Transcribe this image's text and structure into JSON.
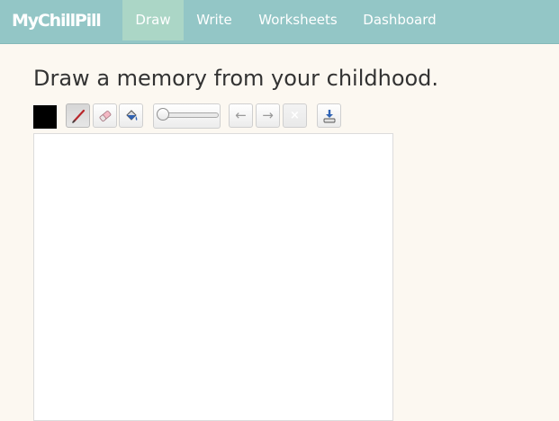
{
  "app": {
    "brand": "MyChillPill"
  },
  "nav": {
    "items": [
      {
        "label": "Draw",
        "active": true
      },
      {
        "label": "Write",
        "active": false
      },
      {
        "label": "Worksheets",
        "active": false
      },
      {
        "label": "Dashboard",
        "active": false
      }
    ]
  },
  "page": {
    "title": "Draw a memory from your childhood."
  },
  "toolbar": {
    "color": "#000000",
    "tools": [
      {
        "icon": "pencil-icon",
        "active": true
      },
      {
        "icon": "eraser-icon",
        "active": false
      },
      {
        "icon": "paint-bucket-icon",
        "active": false
      }
    ],
    "brush_size_level": 0.0,
    "undo_glyph": "←",
    "redo_glyph": "→",
    "clear_glyph": "×",
    "save_icon": "download-icon"
  },
  "colors": {
    "navbar": "#93c6c6",
    "nav_active": "#abd6c6",
    "background": "#fcf8f1",
    "canvas": "#ffffff"
  }
}
